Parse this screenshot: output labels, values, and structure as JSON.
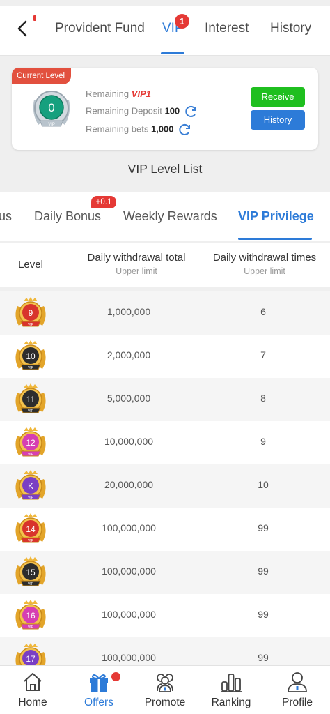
{
  "header": {
    "tabs": [
      {
        "label": "Provident Fund",
        "active": false
      },
      {
        "label": "VIP",
        "active": true,
        "badge": "1"
      },
      {
        "label": "Interest",
        "active": false
      },
      {
        "label": "History",
        "active": false
      }
    ]
  },
  "level_card": {
    "tag": "Current Level",
    "badge_level": "0",
    "badge_text": "VIP",
    "remaining_label": "Remaining",
    "remaining_value": "VIP1",
    "deposit_label": "Remaining Deposit",
    "deposit_value": "100",
    "bets_label": "Remaining bets",
    "bets_value": "1,000",
    "receive_button": "Receive",
    "history_button": "History"
  },
  "level_list_title": "VIP Level List",
  "subtabs": [
    {
      "label": "us",
      "active": false
    },
    {
      "label": "Daily Bonus",
      "active": false,
      "badge": "+0.1"
    },
    {
      "label": "Weekly Rewards",
      "active": false
    },
    {
      "label": "VIP Privilege",
      "active": true
    }
  ],
  "table": {
    "columns": [
      {
        "title": "Level",
        "subtitle": ""
      },
      {
        "title": "Daily withdrawal total",
        "subtitle": "Upper limit"
      },
      {
        "title": "Daily withdrawal times",
        "subtitle": "Upper limit"
      }
    ],
    "rows": [
      {
        "level": "9",
        "total": "1,000,000",
        "times": "6",
        "color": "#d8342c"
      },
      {
        "level": "10",
        "total": "2,000,000",
        "times": "7",
        "color": "#2d2d2d"
      },
      {
        "level": "11",
        "total": "5,000,000",
        "times": "8",
        "color": "#2d2d2d"
      },
      {
        "level": "12",
        "total": "10,000,000",
        "times": "9",
        "color": "#d63fb2"
      },
      {
        "level": "K",
        "total": "20,000,000",
        "times": "10",
        "color": "#7a3fc4"
      },
      {
        "level": "14",
        "total": "100,000,000",
        "times": "99",
        "color": "#d8342c"
      },
      {
        "level": "15",
        "total": "100,000,000",
        "times": "99",
        "color": "#2d2d2d"
      },
      {
        "level": "16",
        "total": "100,000,000",
        "times": "99",
        "color": "#d63fb2"
      },
      {
        "level": "17",
        "total": "100,000,000",
        "times": "99",
        "color": "#7a3fc4"
      }
    ]
  },
  "nav": [
    {
      "label": "Home",
      "icon": "home-icon",
      "active": false
    },
    {
      "label": "Offers",
      "icon": "gift-icon",
      "active": true
    },
    {
      "label": "Promote",
      "icon": "people-icon",
      "active": false
    },
    {
      "label": "Ranking",
      "icon": "bar-chart-icon",
      "active": false
    },
    {
      "label": "Profile",
      "icon": "person-icon",
      "active": false
    }
  ],
  "colors": {
    "accent": "#2d7bd8",
    "receive": "#1fbf1f",
    "badge_red": "#e53935"
  }
}
